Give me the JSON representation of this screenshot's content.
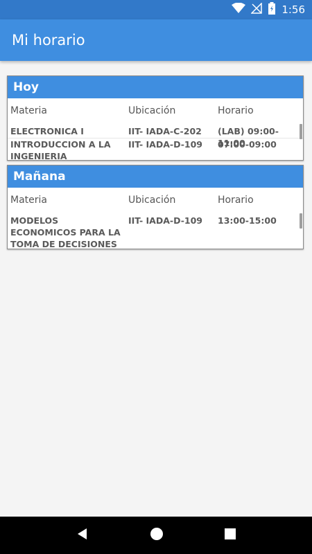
{
  "status_bar": {
    "time": "1:56",
    "icons": [
      "wifi-icon",
      "no-signal-icon",
      "battery-icon"
    ]
  },
  "app_bar": {
    "title": "Mi horario"
  },
  "columns": {
    "materia": "Materia",
    "ubicacion": "Ubicación",
    "horario": "Horario"
  },
  "today": {
    "title": "Hoy",
    "rows": [
      {
        "materia": "ELECTRONICA I",
        "ubicacion": "IIT- IADA-C-202",
        "horario": "(LAB) 09:00-11:00"
      },
      {
        "materia": "INTRODUCCION A LA INGENIERIA",
        "ubicacion": "IIT- IADA-D-109",
        "horario": "07:00-09:00"
      }
    ]
  },
  "tomorrow": {
    "title": "Mañana",
    "rows": [
      {
        "materia": "MODELOS ECONOMICOS PARA LA TOMA DE DECISIONES",
        "ubicacion": "IIT- IADA-D-109",
        "horario": "13:00-15:00"
      }
    ]
  },
  "nav": {
    "buttons": [
      "back-icon",
      "home-icon",
      "recents-icon"
    ]
  },
  "colors": {
    "primary": "#3f8ee0",
    "status_bar": "#3279c9",
    "text_muted": "#5a5a5a"
  }
}
